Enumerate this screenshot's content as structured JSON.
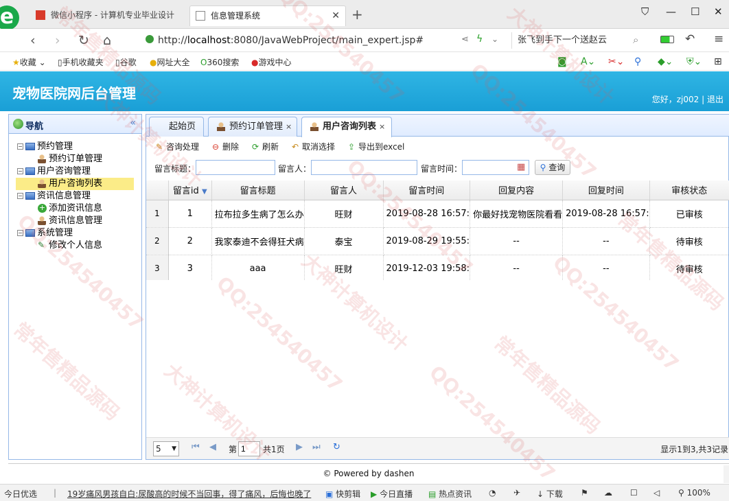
{
  "browser": {
    "tabs": [
      {
        "title": "微信小程序 - 计算机专业毕业设计"
      },
      {
        "title": "信息管理系统"
      }
    ],
    "url_prefix": "http://",
    "url_host": "localhost",
    "url_rest": ":8080/JavaWebProject/main_expert.jsp#",
    "search_text": "张飞到手下一个送赵云",
    "bookmarks": [
      {
        "label": "收藏"
      },
      {
        "label": "手机收藏夹"
      },
      {
        "label": "谷歌"
      },
      {
        "label": "网址大全"
      },
      {
        "label": "360搜索"
      },
      {
        "label": "游戏中心"
      }
    ]
  },
  "app": {
    "title": "宠物医院网后台管理",
    "greeting": "您好，zj002 |",
    "logout": "退出",
    "accent_color": "#1a9fd6"
  },
  "sidebar": {
    "title": "导航",
    "tree": [
      {
        "label": "预约管理",
        "kind": "folder"
      },
      {
        "label": "预约订单管理",
        "kind": "user"
      },
      {
        "label": "用户咨询管理",
        "kind": "folder"
      },
      {
        "label": "用户咨询列表",
        "kind": "user",
        "selected": true
      },
      {
        "label": "资讯信息管理",
        "kind": "folder"
      },
      {
        "label": "添加资讯信息",
        "kind": "add"
      },
      {
        "label": "资讯信息管理",
        "kind": "user"
      },
      {
        "label": "系统管理",
        "kind": "folder"
      },
      {
        "label": "修改个人信息",
        "kind": "pen"
      }
    ]
  },
  "tabs": [
    {
      "label": "起始页"
    },
    {
      "label": "预约订单管理",
      "close": "×"
    },
    {
      "label": "用户咨询列表",
      "close": "×",
      "active": true
    }
  ],
  "toolbar": {
    "process": "咨询处理",
    "delete": "删除",
    "refresh": "刷新",
    "cancel_select": "取消选择",
    "export": "导出到excel"
  },
  "filters": {
    "title_label": "留言标题：",
    "author_label": "留言人：",
    "time_label": "留言时间：",
    "query": "查询"
  },
  "grid": {
    "columns": [
      "留言id",
      "留言标题",
      "留言人",
      "留言时间",
      "回复内容",
      "回复时间",
      "审核状态"
    ],
    "rows": [
      {
        "rn": "1",
        "id": "1",
        "title": "拉布拉多生病了怎么办",
        "author": "旺财",
        "time": "2019-08-28 16:57:",
        "reply": "你最好找宠物医院看看",
        "reply_time": "2019-08-28 16:57:",
        "status": "已审核"
      },
      {
        "rn": "2",
        "id": "2",
        "title": "我家泰迪不会得狂犬病",
        "author": "泰宝",
        "time": "2019-08-29 19:55:",
        "reply": "--",
        "reply_time": "--",
        "status": "待审核"
      },
      {
        "rn": "3",
        "id": "3",
        "title": "aaa",
        "author": "旺财",
        "time": "2019-12-03 19:58:",
        "reply": "--",
        "reply_time": "--",
        "status": "待审核"
      }
    ]
  },
  "pager": {
    "page_size": "5",
    "page_label": "第",
    "page_value": "1",
    "total_pages": "共1页",
    "summary": "显示1到3,共3记录"
  },
  "footer": "© Powered by dashen",
  "statusbar": {
    "left": "今日优选",
    "news": "19岁痛风男孩自白:尿酸高的时候不当回事，得了痛风，后悔也晚了",
    "items": [
      "快剪辑",
      "今日直播",
      "热点资讯",
      "下载"
    ],
    "zoom": "100%"
  },
  "watermarks": [
    "QQ:254540457",
    "大神计算机设计",
    "常年售精品源码"
  ]
}
